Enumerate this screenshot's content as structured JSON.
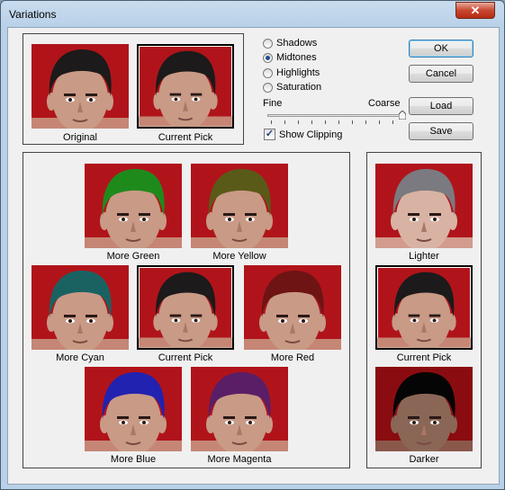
{
  "window": {
    "title": "Variations",
    "close_glyph": "✕"
  },
  "top_preview": {
    "original_label": "Original",
    "current_pick_label": "Current Pick"
  },
  "tones": {
    "options": [
      "Shadows",
      "Midtones",
      "Highlights",
      "Saturation"
    ],
    "selected": "Midtones"
  },
  "slider": {
    "fine_label": "Fine",
    "coarse_label": "Coarse",
    "level": "Coarse"
  },
  "show_clipping": {
    "label": "Show Clipping",
    "checked": true
  },
  "buttons": {
    "ok": "OK",
    "cancel": "Cancel",
    "load": "Load",
    "save": "Save"
  },
  "color_variations": {
    "more_green": "More Green",
    "more_yellow": "More Yellow",
    "more_cyan": "More Cyan",
    "current_pick": "Current Pick",
    "more_red": "More Red",
    "more_blue": "More Blue",
    "more_magenta": "More Magenta"
  },
  "brightness_variations": {
    "lighter": "Lighter",
    "current_pick": "Current Pick",
    "darker": "Darker"
  },
  "colors": {
    "background_red": "#b0141a",
    "skin": "#c99a86",
    "hair_normal": "#1c1a1a",
    "hair_green": "#1f8a1c",
    "hair_yellow": "#5a5a18",
    "hair_cyan": "#1a6262",
    "hair_red": "#6e1414",
    "hair_blue": "#2222b0",
    "hair_magenta": "#5a1e66",
    "hair_lighter": "#7a7a80",
    "hair_darker": "#050505"
  }
}
